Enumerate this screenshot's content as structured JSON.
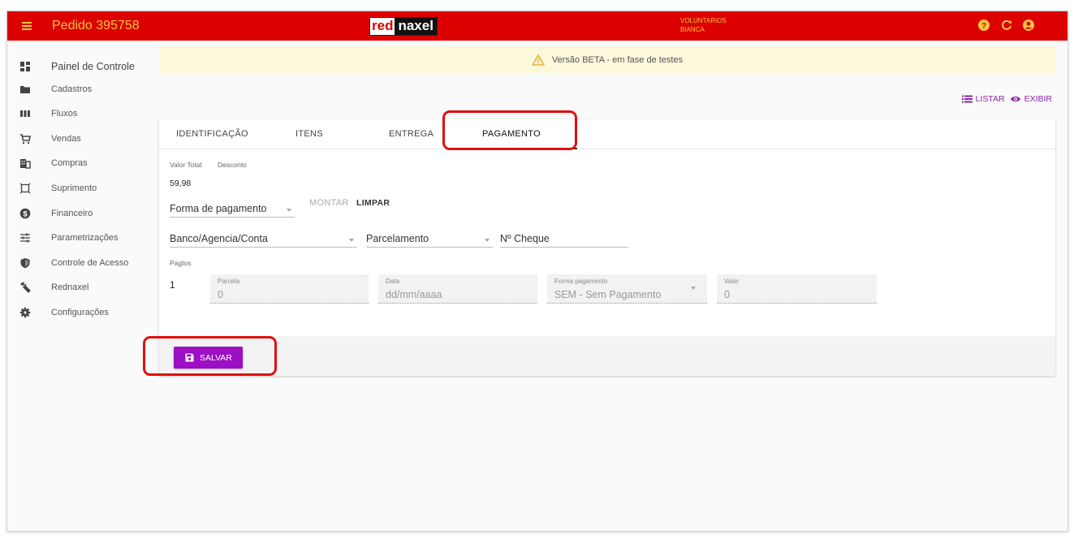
{
  "topbar": {
    "title": "Pedido 395758",
    "logo_red": "red",
    "logo_naxel": "naxel",
    "user_line1": "VOLUNTARIOS",
    "user_line2": "BIANCA",
    "icons": [
      "help-icon",
      "refresh-icon",
      "account-icon"
    ],
    "bar_color": "#dd0000",
    "text_color": "#f5c542"
  },
  "sidebar": {
    "items": [
      {
        "label": "Painel de Controle",
        "icon": "dashboard-icon"
      },
      {
        "label": "Cadastros",
        "icon": "folder-icon"
      },
      {
        "label": "Fluxos",
        "icon": "columns-icon"
      },
      {
        "label": "Vendas",
        "icon": "cart-icon"
      },
      {
        "label": "Compras",
        "icon": "building-icon"
      },
      {
        "label": "Suprimento",
        "icon": "box-icon"
      },
      {
        "label": "Financeiro",
        "icon": "money-icon"
      },
      {
        "label": "Parametrizações",
        "icon": "sliders-icon"
      },
      {
        "label": "Controle de Acesso",
        "icon": "shield-icon"
      },
      {
        "label": "Rednaxel",
        "icon": "wrench-icon"
      },
      {
        "label": "Configurações",
        "icon": "gear-icon"
      }
    ]
  },
  "banner": {
    "text": "Versão BETA - em fase de testes",
    "icon": "warning-icon"
  },
  "actions": {
    "list_label": "LISTAR",
    "view_label": "EXIBIR",
    "accent": "#8e24aa"
  },
  "tabs": [
    {
      "label": "IDENTIFICAÇÃO"
    },
    {
      "label": "ITENS"
    },
    {
      "label": "ENTREGA"
    },
    {
      "label": "PAGAMENTO",
      "active": true
    }
  ],
  "payment": {
    "total_label": "Valor Total",
    "discount_label": "Desconto",
    "total_value": "59,98",
    "payment_method_select": "Forma de pagamento",
    "montar_label": "MONTAR",
    "limpar_label": "LIMPAR",
    "bank_select": "Banco/Agencia/Conta",
    "installments_select": "Parcelamento",
    "cheque_placeholder": "Nº Cheque",
    "pagtos_label": "Pagtos",
    "row_number": "1",
    "fields": {
      "parcela_label": "Parcela",
      "parcela_value": "0",
      "data_label": "Data",
      "data_value": "dd/mm/aaaa",
      "forma_label": "Forma pagamento",
      "forma_value": "SEM - Sem Pagamento",
      "valor_label": "Valor",
      "valor_value": "0"
    }
  },
  "footer": {
    "save_label": "SALVAR",
    "save_color": "#9c0fc4"
  }
}
